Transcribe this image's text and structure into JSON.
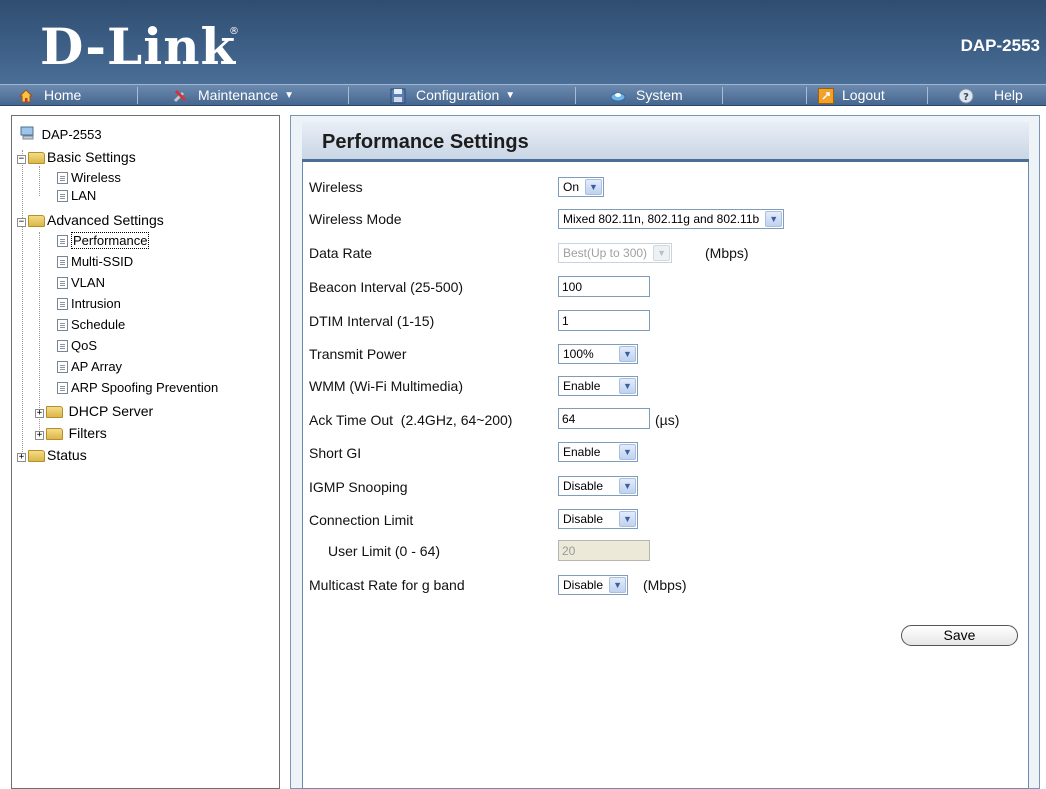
{
  "header": {
    "logo": "D-Link",
    "logo_mark": "®",
    "model": "DAP-2553"
  },
  "nav": [
    {
      "label": "Home",
      "icon": "home-icon"
    },
    {
      "label": "Maintenance",
      "icon": "tools-icon",
      "dropdown": true
    },
    {
      "label": "Configuration",
      "icon": "save-disk-icon",
      "dropdown": true
    },
    {
      "label": "System",
      "icon": "system-icon"
    },
    {
      "label": "Logout",
      "icon": "logout-icon"
    },
    {
      "label": "Help",
      "icon": "help-icon"
    }
  ],
  "tree": {
    "root": "DAP-2553",
    "basic": "Basic Settings",
    "basic_items": [
      "Wireless",
      "LAN"
    ],
    "advanced": "Advanced Settings",
    "advanced_items": [
      "Performance",
      "Multi-SSID",
      "VLAN",
      "Intrusion",
      "Schedule",
      "QoS",
      "AP Array",
      "ARP Spoofing Prevention"
    ],
    "dhcp": "DHCP Server",
    "filters": "Filters",
    "status": "Status"
  },
  "page": {
    "title": "Performance Settings",
    "fields": {
      "wireless": {
        "label": "Wireless",
        "value": "On"
      },
      "wireless_mode": {
        "label": "Wireless Mode",
        "value": "Mixed 802.11n, 802.11g and 802.11b"
      },
      "data_rate": {
        "label": "Data Rate",
        "value": "Best(Up to 300)",
        "unit": "(Mbps)"
      },
      "beacon_interval": {
        "label": "Beacon Interval (25-500)",
        "value": "100"
      },
      "dtim_interval": {
        "label": "DTIM Interval (1-15)",
        "value": "1"
      },
      "transmit_power": {
        "label": "Transmit Power",
        "value": "100%"
      },
      "wmm": {
        "label": "WMM (Wi-Fi Multimedia)",
        "value": "Enable"
      },
      "ack_timeout": {
        "label": "Ack Time Out  (2.4GHz, 64~200)",
        "value": "64",
        "unit": "(µs)"
      },
      "short_gi": {
        "label": "Short GI",
        "value": "Enable"
      },
      "igmp_snooping": {
        "label": "IGMP Snooping",
        "value": "Disable"
      },
      "connection_limit": {
        "label": "Connection Limit",
        "value": "Disable"
      },
      "user_limit": {
        "label": "User Limit (0 - 64)",
        "value": "20"
      },
      "multicast_rate": {
        "label": "Multicast Rate for g band",
        "value": "Disable",
        "unit": "(Mbps)"
      }
    },
    "save_label": "Save"
  },
  "colors": {
    "header": "#3d5f86",
    "navbar": "#45668f",
    "title_border": "#4b6d96"
  }
}
